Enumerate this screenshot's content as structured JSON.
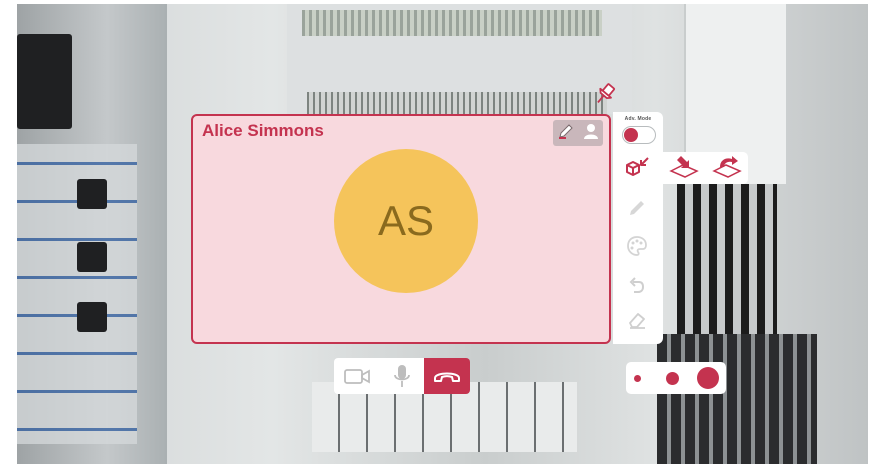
{
  "participant": {
    "name": "Alice Simmons",
    "initials": "AS"
  },
  "tools": {
    "adv_mode_label": "Adv. Mode",
    "adv_mode_on": true,
    "items": [
      "3d-box-tool",
      "pen-tool",
      "color-palette",
      "undo",
      "eraser"
    ]
  },
  "flyout": {
    "items": [
      "place-arrow-down",
      "place-arrow-curve"
    ]
  },
  "call_controls": {
    "items": [
      "camera-toggle",
      "microphone-toggle",
      "end-call"
    ]
  },
  "brush_sizes": [
    "small",
    "medium",
    "large"
  ],
  "colors": {
    "accent": "#c4334f",
    "tile_bg": "#f8d9de",
    "avatar_bg": "#f5c45b",
    "avatar_text": "#8a6a1e"
  }
}
